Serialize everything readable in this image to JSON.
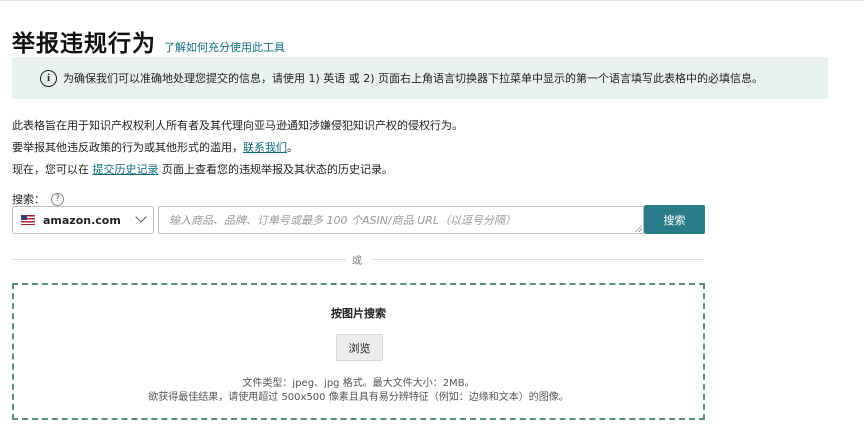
{
  "header": {
    "title": "举报违规行为",
    "help_link": "了解如何充分使用此工具"
  },
  "notice": {
    "text": "为确保我们可以准确地处理您提交的信息，请使用 1) 英语 或 2) 页面右上角语言切换器下拉菜单中显示的第一个语言填写此表格中的必填信息。"
  },
  "intro": {
    "line1": "此表格旨在用于知识产权权利人所有者及其代理向亚马逊通知涉嫌侵犯知识产权的侵权行为。",
    "line2_prefix": "要举报其他违反政策的行为或其他形式的滥用，",
    "line2_link": "联系我们",
    "line2_suffix": "。",
    "line3_prefix": "现在，您可以在 ",
    "line3_link": "提交历史记录",
    "line3_suffix": " 页面上查看您的违规举报及其状态的历史记录。"
  },
  "search": {
    "label": "搜索：",
    "help_icon": "?",
    "marketplace": "amazon.com",
    "placeholder": "输入商品、品牌、订单号或最多 100 个ASIN/商品 URL（以逗号分隔）",
    "button": "搜索"
  },
  "separator": {
    "text": "或"
  },
  "image_search": {
    "title": "按图片搜索",
    "browse_button": "浏览",
    "file_note": "文件类型：jpeg、jpg 格式。最大文件大小：2MB。",
    "quality_note": "欲获得最佳结果，请使用超过 500x500 像素且具有易分辨特征（例如：边缘和文本）的图像。"
  },
  "colors": {
    "accent": "#2b7b89",
    "link": "#0f6b7a",
    "notice_bg": "#e9f2f1",
    "dropzone_border": "#5c8c86"
  },
  "icons": {
    "info": "info-icon",
    "help": "question-icon",
    "flag": "us-flag-icon",
    "chevron": "chevron-down-icon"
  }
}
